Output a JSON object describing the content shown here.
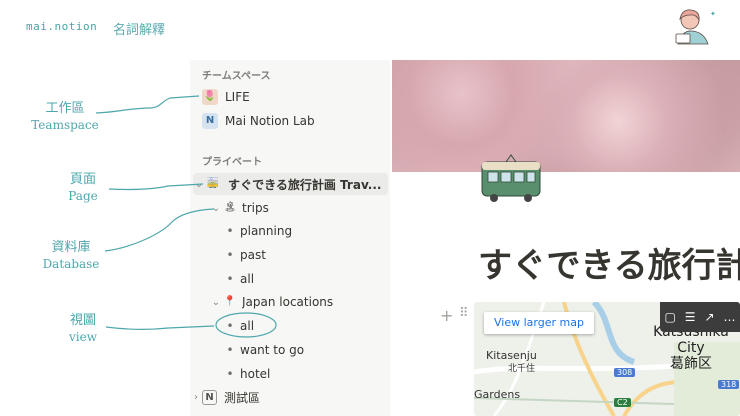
{
  "header": {
    "brand": "mai.notion",
    "title": "名詞解釋"
  },
  "annotations": [
    {
      "cn": "工作區",
      "en": "Teamspace"
    },
    {
      "cn": "頁面",
      "en": "Page"
    },
    {
      "cn": "資料庫",
      "en": "Database"
    },
    {
      "cn": "視圖",
      "en": "view"
    }
  ],
  "sidebar": {
    "teamspace_header": "チームスペース",
    "teamspaces": [
      {
        "label": "LIFE",
        "icon": "tulip-icon"
      },
      {
        "label": "Mai Notion Lab",
        "icon": "notion-icon"
      }
    ],
    "private_header": "プライベート",
    "trip_page": {
      "label": "すぐできる旅行計画 Trav...",
      "icon": "tram-icon"
    },
    "trips_db": {
      "label": "trips",
      "icon": "island-icon"
    },
    "trips_views": [
      "planning",
      "past",
      "all"
    ],
    "japan_db": {
      "label": "Japan locations",
      "icon": "pin-icon"
    },
    "japan_views": [
      "all",
      "want to go",
      "hotel"
    ],
    "test_page": {
      "label": "測試區",
      "icon": "notion-icon"
    }
  },
  "main": {
    "title": "すぐできる旅行計",
    "map": {
      "link": "View larger map",
      "city_en": "Katsushika City",
      "city_jp": "葛飾区",
      "kitasenju": "Kitasenju",
      "kitasenju_jp": "北千住",
      "gardens": "Gardens",
      "route1": "308",
      "route2": "318",
      "route3": "C2"
    }
  },
  "colors": {
    "annotation": "#4ea7ac",
    "sidebar_bg": "#f7f7f5",
    "text": "#37352f"
  }
}
